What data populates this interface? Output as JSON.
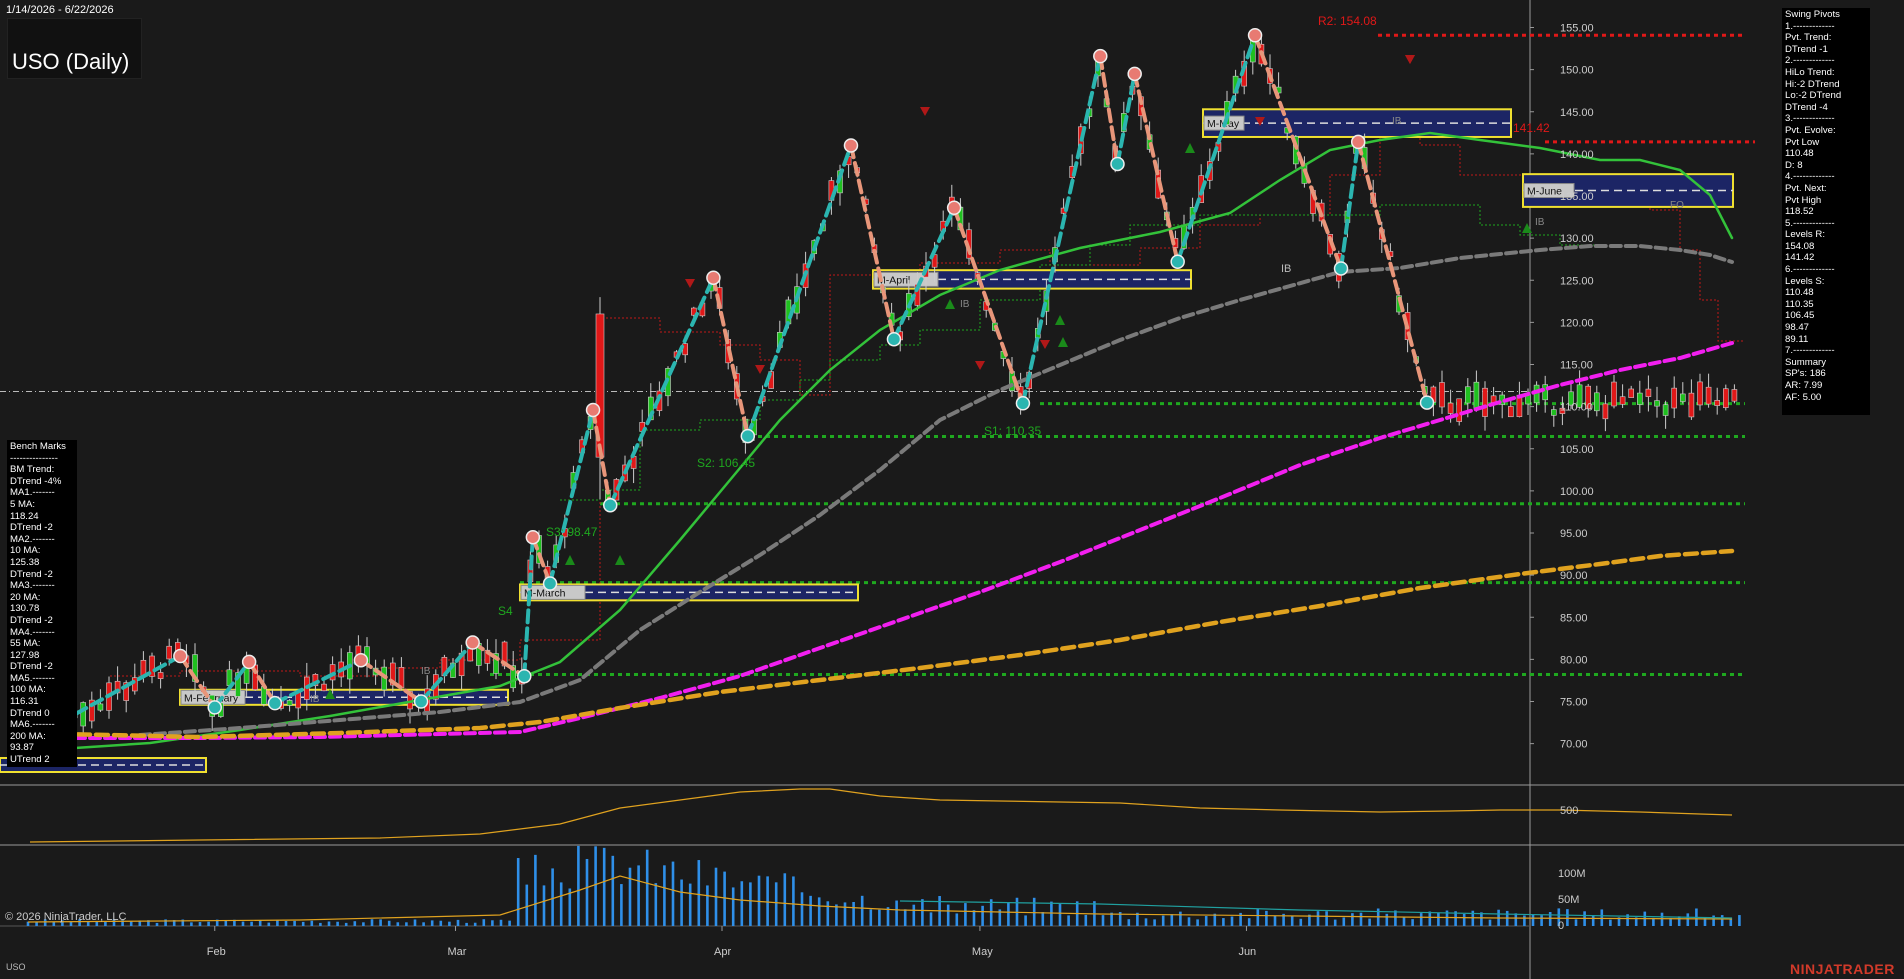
{
  "header": {
    "date_range": "1/14/2026 - 6/22/2026",
    "title": "USO (Daily)"
  },
  "footer": {
    "copyright": "© 2026 NinjaTrader, LLC",
    "symbol": "USO",
    "brand": "NINJATRADER"
  },
  "swing_pivots_panel": [
    "Swing Pivots",
    "1.-------------",
    "Pvt. Trend:",
    "DTrend -1",
    "2.-------------",
    "HiLo Trend:",
    "Hi:-2 DTrend",
    "Lo:-2 DTrend",
    "DTrend -4",
    "3.-------------",
    "Pvt. Evolve:",
    "Pvt Low",
    "110.48",
    "D: 8",
    "4.-------------",
    "Pvt. Next:",
    "Pvt High",
    "118.52",
    "5.-------------",
    "Levels R:",
    "154.08",
    "141.42",
    "6.-------------",
    "Levels S:",
    "110.48",
    "110.35",
    "106.45",
    "98.47",
    "89.11",
    "7.-------------",
    "Summary",
    "SP's: 186",
    "AR: 7.99",
    "AF: 5.00"
  ],
  "bench_marks_panel": [
    "Bench Marks",
    "---------------",
    "BM Trend:",
    "DTrend -4%",
    "MA1.-------",
    "5 MA:",
    "118.24",
    "DTrend -2",
    "MA2.-------",
    "10 MA:",
    "125.38",
    "DTrend -2",
    "MA3.-------",
    "20 MA:",
    "130.78",
    "DTrend -2",
    "MA4.-------",
    "55 MA:",
    "127.98",
    "DTrend -2",
    "MA5.-------",
    "100 MA:",
    "116.31",
    "DTrend 0",
    "MA6.-------",
    "200 MA:",
    "93.87",
    "UTrend 2"
  ],
  "colors": {
    "background": "#1a1a1a",
    "zigzag_up": "#2bb5b0",
    "zigzag_down": "#e8967a",
    "ma_green": "#33c23a",
    "ma_gray": "#7a7a7a",
    "ma_magenta": "#f21ff0",
    "ma_orange": "#e0a21f",
    "resistance": "#e01818",
    "support": "#1fa81f",
    "volume": "#2f8fe8",
    "monthly_box_border": "#f0e030",
    "monthly_box_fill": "#1c2565"
  },
  "chart_data": {
    "type": "candlestick",
    "date_range": [
      "2026-01-14",
      "2026-06-22"
    ],
    "x_ticks": [
      "Feb",
      "Mar",
      "Apr",
      "May",
      "Jun"
    ],
    "y_ticks": [
      "155.00",
      "150.00",
      "145.00",
      "140.00",
      "135.00",
      "130.00",
      "125.00",
      "120.00",
      "115.00",
      "110.00",
      "105.00",
      "100.00",
      "95.00",
      "90.00",
      "85.00",
      "80.00",
      "75.00",
      "70.00"
    ],
    "ylim": [
      66.4,
      158.7
    ],
    "resistance_levels": [
      {
        "label": "R2: 154.08",
        "value": 154.08
      },
      {
        "label": "141.42",
        "value": 141.42
      }
    ],
    "support_levels": [
      {
        "label": "S1: 110.35",
        "value": 110.35
      },
      {
        "label": "S2: 106.45",
        "value": 106.45
      },
      {
        "label": "S3: 98.47",
        "value": 98.47
      },
      {
        "label": "S4",
        "value": 89.11
      },
      {
        "label": "",
        "value": 78.2
      }
    ],
    "swing_pivots": [
      {
        "date": "2026-01-14",
        "price": 72.5
      },
      {
        "date": "2026-01-28",
        "price": 80.4
      },
      {
        "date": "2026-02-01",
        "price": 74.3
      },
      {
        "date": "2026-02-05",
        "price": 79.7
      },
      {
        "date": "2026-02-08",
        "price": 74.8
      },
      {
        "date": "2026-02-18",
        "price": 79.9
      },
      {
        "date": "2026-02-25",
        "price": 75.0
      },
      {
        "date": "2026-03-03",
        "price": 82.0
      },
      {
        "date": "2026-03-09",
        "price": 78.0
      },
      {
        "date": "2026-03-10",
        "price": 94.5
      },
      {
        "date": "2026-03-12",
        "price": 89.0
      },
      {
        "date": "2026-03-17",
        "price": 109.6
      },
      {
        "date": "2026-03-19",
        "price": 98.3
      },
      {
        "date": "2026-03-31",
        "price": 125.3
      },
      {
        "date": "2026-04-04",
        "price": 106.5
      },
      {
        "date": "2026-04-16",
        "price": 141.0
      },
      {
        "date": "2026-04-21",
        "price": 118.0
      },
      {
        "date": "2026-04-28",
        "price": 133.6
      },
      {
        "date": "2026-05-06",
        "price": 110.4
      },
      {
        "date": "2026-05-15",
        "price": 151.6
      },
      {
        "date": "2026-05-17",
        "price": 138.8
      },
      {
        "date": "2026-05-19",
        "price": 149.5
      },
      {
        "date": "2026-05-24",
        "price": 127.2
      },
      {
        "date": "2026-06-02",
        "price": 154.08
      },
      {
        "date": "2026-06-12",
        "price": 126.4
      },
      {
        "date": "2026-06-14",
        "price": 141.42
      },
      {
        "date": "2026-06-22",
        "price": 110.48
      }
    ],
    "moving_averages": [
      {
        "name": "20 MA",
        "color": "#33c23a",
        "last": 130.78
      },
      {
        "name": "55 MA",
        "color": "#7a7a7a",
        "last": 127.98
      },
      {
        "name": "100 MA",
        "color": "#f21ff0",
        "last": 116.31
      },
      {
        "name": "200 MA",
        "color": "#e0a21f",
        "last": 93.87
      }
    ],
    "monthly_ranges": [
      {
        "label": "M-February",
        "high": 75.8,
        "low": 75.2
      },
      {
        "label": "M-March",
        "high": 88.3,
        "low": 87.6
      },
      {
        "label": "M-April",
        "high": 125.6,
        "low": 124.6
      },
      {
        "label": "M-May",
        "high": 144.7,
        "low": 142.6
      },
      {
        "label": "M-June",
        "high": 137.0,
        "low": 134.3
      }
    ],
    "volume_axis": [
      "100M",
      "50M",
      "0"
    ],
    "oscillator_axis": [
      "500"
    ]
  },
  "annotations": {
    "r2": "R2: 154.08",
    "r1": "141.42",
    "s1": "S1: 110.35",
    "s2": "S2: 106.45",
    "s3": "S3: 98.47",
    "s4": "S4",
    "ib": "IB",
    "fo": "FO"
  }
}
